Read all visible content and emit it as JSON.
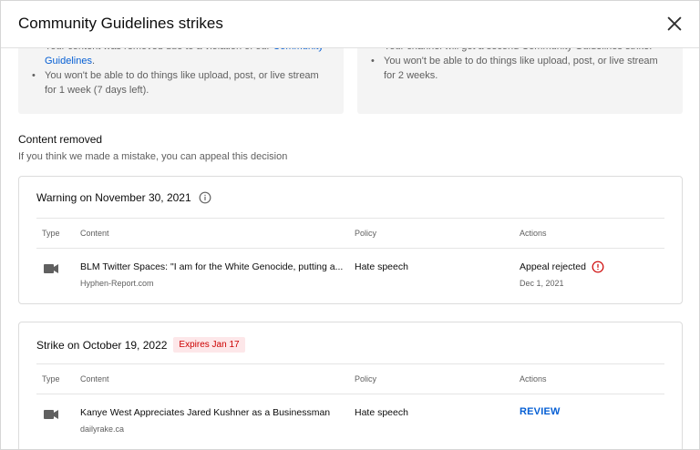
{
  "dialog": {
    "title": "Community Guidelines strikes"
  },
  "info_cards": {
    "left": {
      "items": [
        {
          "text": "Your content was removed due to a violation of our ",
          "link": "Community Guidelines",
          "suffix": "."
        },
        {
          "text": "You won't be able to do things like upload, post, or live stream for 1 week (7 days left)."
        }
      ]
    },
    "right": {
      "items": [
        {
          "text": "Your channel will get a second Community Guidelines strike."
        },
        {
          "text": "You won't be able to do things like upload, post, or live stream for 2 weeks."
        }
      ]
    }
  },
  "content_removed": {
    "title": "Content removed",
    "subtitle": "If you think we made a mistake, you can appeal this decision"
  },
  "table_headers": {
    "type": "Type",
    "content": "Content",
    "policy": "Policy",
    "actions": "Actions"
  },
  "cards": [
    {
      "heading": "Warning on November 30, 2021",
      "badge": "",
      "row": {
        "title": "BLM Twitter Spaces: \"I am for the White Genocide, putting a...",
        "source": "Hyphen-Report.com",
        "policy": "Hate speech",
        "action_status": "Appeal rejected",
        "action_date": "Dec 1, 2021"
      }
    },
    {
      "heading": "Strike on October 19, 2022",
      "badge": "Expires Jan 17",
      "row": {
        "title": "Kanye West Appreciates Jared Kushner as a Businessman",
        "source": "dailyrake.ca",
        "policy": "Hate speech",
        "action_button": "REVIEW"
      }
    }
  ],
  "icons": {
    "close": "close-icon",
    "info": "info-icon",
    "error": "error-icon",
    "video": "video-camera-icon"
  },
  "colors": {
    "link": "#065fd4",
    "error": "#cc0000",
    "badge_bg": "#fde7e9"
  }
}
